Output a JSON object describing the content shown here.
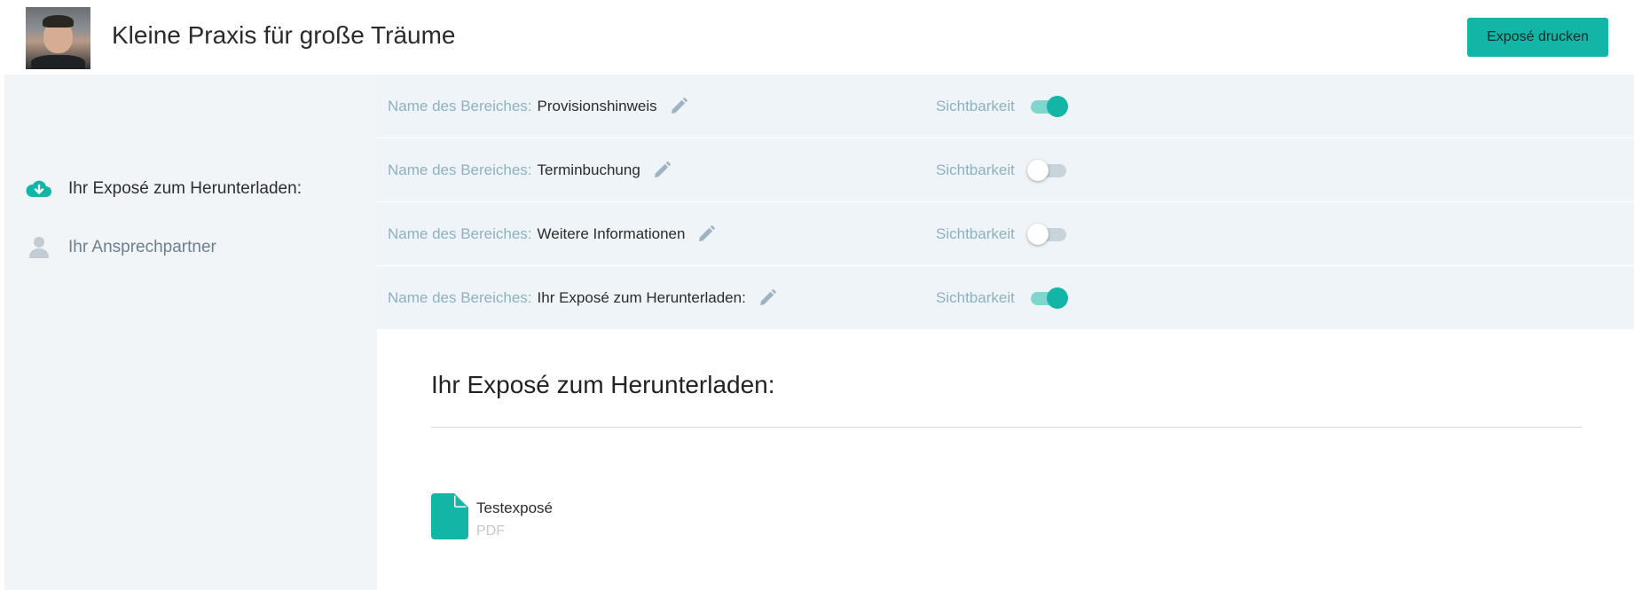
{
  "header": {
    "title": "Kleine Praxis für große Träume",
    "print_button": "Exposé drucken",
    "avatar_icon": "user-photo"
  },
  "sidebar": {
    "items": [
      {
        "label": "Ihr Exposé zum Herunterladen:",
        "icon": "cloud-download-icon",
        "active": true
      },
      {
        "label": "Ihr Ansprechpartner",
        "icon": "person-icon",
        "active": false
      }
    ]
  },
  "sections": {
    "name_label": "Name des Bereiches:",
    "visibility_label": "Sichtbarkeit",
    "rows": [
      {
        "name": "Provisionshinweis",
        "visible": true
      },
      {
        "name": "Terminbuchung",
        "visible": false
      },
      {
        "name": "Weitere Informationen",
        "visible": false
      },
      {
        "name": "Ihr Exposé zum Herunterladen:",
        "visible": true
      }
    ]
  },
  "content": {
    "title": "Ihr Exposé zum Herunterladen:",
    "file": {
      "name": "Testexposé",
      "type": "PDF",
      "icon": "document-icon"
    }
  },
  "colors": {
    "accent": "#12b5a6",
    "sidebar_bg": "#f1f5f8",
    "sections_bg": "#eef4f7",
    "muted_label": "#8fb0c3"
  }
}
